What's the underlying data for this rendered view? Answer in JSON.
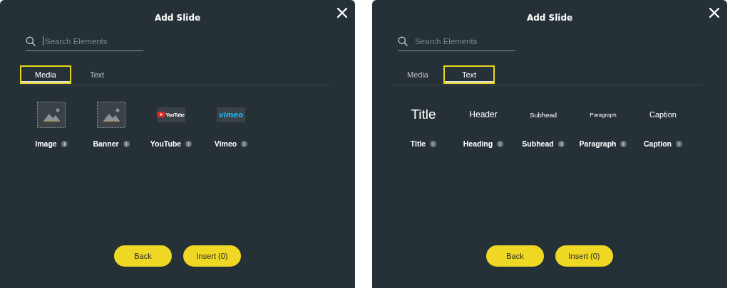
{
  "dialogs": [
    {
      "title": "Add Slide",
      "search": {
        "placeholder": "Search Elements",
        "focused": true
      },
      "tabs": [
        {
          "label": "Media",
          "selected": true,
          "highlighted": true
        },
        {
          "label": "Text",
          "selected": false,
          "highlighted": false
        }
      ],
      "elements": [
        {
          "kind": "image",
          "label": "Image"
        },
        {
          "kind": "image",
          "label": "Banner"
        },
        {
          "kind": "youtube",
          "preview": "YouTube",
          "label": "YouTube"
        },
        {
          "kind": "vimeo",
          "preview": "vimeo",
          "label": "Vimeo"
        }
      ],
      "buttons": [
        "Back",
        "Insert (0)"
      ]
    },
    {
      "title": "Add Slide",
      "search": {
        "placeholder": "Search Elements",
        "focused": false
      },
      "tabs": [
        {
          "label": "Media",
          "selected": false,
          "highlighted": false
        },
        {
          "label": "Text",
          "selected": true,
          "highlighted": true
        }
      ],
      "elements": [
        {
          "kind": "title",
          "preview": "Title",
          "label": "Title"
        },
        {
          "kind": "header",
          "preview": "Header",
          "label": "Heading"
        },
        {
          "kind": "subhead",
          "preview": "Subhead",
          "label": "Subhead"
        },
        {
          "kind": "paragraph",
          "preview": "Paragraph",
          "label": "Paragraph"
        },
        {
          "kind": "caption",
          "preview": "Caption",
          "label": "Caption"
        }
      ],
      "buttons": [
        "Back",
        "Insert (0)"
      ]
    }
  ]
}
